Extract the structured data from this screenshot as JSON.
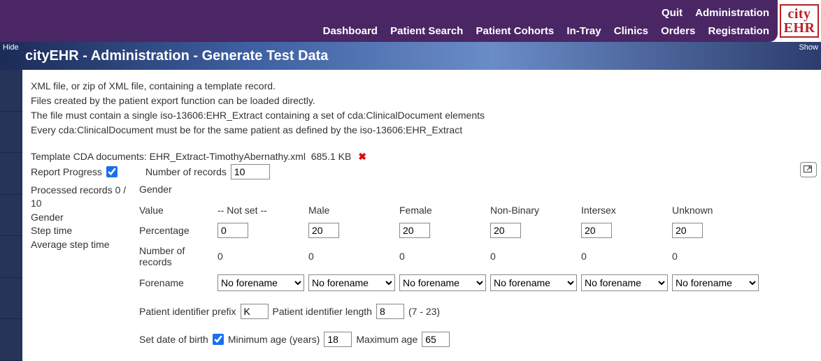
{
  "header": {
    "quit": "Quit",
    "administration": "Administration",
    "dashboard": "Dashboard",
    "patient_search": "Patient Search",
    "patient_cohorts": "Patient Cohorts",
    "in_tray": "In-Tray",
    "clinics": "Clinics",
    "orders": "Orders",
    "registration": "Registration",
    "logo_top": "city",
    "logo_bottom": "EHR"
  },
  "subheader": {
    "hide": "Hide",
    "show": "Show",
    "title": "cityEHR - Administration - Generate Test Data"
  },
  "instructions": {
    "l1": "XML file, or zip of XML file, containing a template record.",
    "l2": "Files created by the patient export function can be loaded directly.",
    "l3": "The file must contain a single iso-13606:EHR_Extract containing a set of cda:ClinicalDocument elements",
    "l4": "Every cda:ClinicalDocument must be for the same patient as defined by the iso-13606:EHR_Extract"
  },
  "template_row": {
    "prefix": "Template CDA documents:",
    "filename": "EHR_Extract-TimothyAbernathy.xml",
    "size": "685.1 KB",
    "remove_icon": "✖"
  },
  "report_progress": {
    "label": "Report Progress",
    "checked": true
  },
  "num_records": {
    "label": "Number of records",
    "value": "10"
  },
  "stats": {
    "processed": "Processed records 0 / 10",
    "gender": "Gender",
    "step": "Step time",
    "avg": "Average step time"
  },
  "gender_section": {
    "title": "Gender",
    "rows": {
      "value": "Value",
      "percentage": "Percentage",
      "numrec": "Number of records",
      "forename": "Forename"
    },
    "cols": {
      "notset": {
        "label": "-- Not set --",
        "pct": "0",
        "nr": "0",
        "fn": "No forename"
      },
      "male": {
        "label": "Male",
        "pct": "20",
        "nr": "0",
        "fn": "No forename"
      },
      "female": {
        "label": "Female",
        "pct": "20",
        "nr": "0",
        "fn": "No forename"
      },
      "nonbin": {
        "label": "Non-Binary",
        "pct": "20",
        "nr": "0",
        "fn": "No forename"
      },
      "inter": {
        "label": "Intersex",
        "pct": "20",
        "nr": "0",
        "fn": "No forename"
      },
      "unk": {
        "label": "Unknown",
        "pct": "20",
        "nr": "0",
        "fn": "No forename"
      }
    }
  },
  "pid": {
    "prefix_label": "Patient identifier prefix",
    "prefix_value": "K",
    "len_label": "Patient identifier length",
    "len_value": "8",
    "len_hint": "(7 - 23)"
  },
  "dob": {
    "set_label": "Set date of birth",
    "checked": true,
    "min_label": "Minimum age (years)",
    "min_value": "18",
    "max_label": "Maximum age",
    "max_value": "65"
  },
  "popup_icon": "�札"
}
